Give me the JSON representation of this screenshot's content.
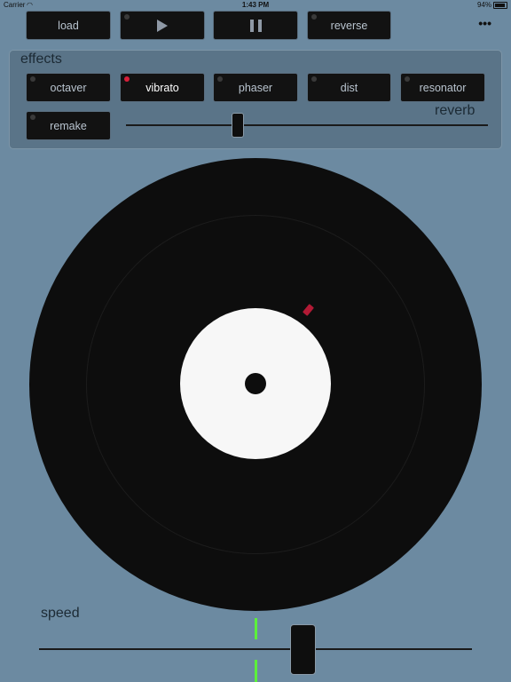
{
  "status": {
    "carrier": "Carrier",
    "time": "1:43 PM",
    "battery": "94%"
  },
  "toolbar": {
    "load": "load",
    "reverse": "reverse",
    "play_icon": "play-icon",
    "pause_icon": "pause-icon",
    "more_icon": "more-icon",
    "more_glyph": "•••"
  },
  "effects": {
    "title": "effects",
    "buttons": [
      {
        "label": "octaver",
        "on": false
      },
      {
        "label": "vibrato",
        "on": true
      },
      {
        "label": "phaser",
        "on": false
      },
      {
        "label": "dist",
        "on": false
      },
      {
        "label": "resonator",
        "on": false
      },
      {
        "label": "remake",
        "on": false
      }
    ],
    "reverb": {
      "label": "reverb",
      "value": 0.31
    }
  },
  "speed": {
    "label": "speed",
    "value": 0.61
  },
  "colors": {
    "background": "#6c8aa1",
    "led_on": "#d81f3a",
    "center_mark": "#5cf03a",
    "record_marker": "#b21a35"
  }
}
